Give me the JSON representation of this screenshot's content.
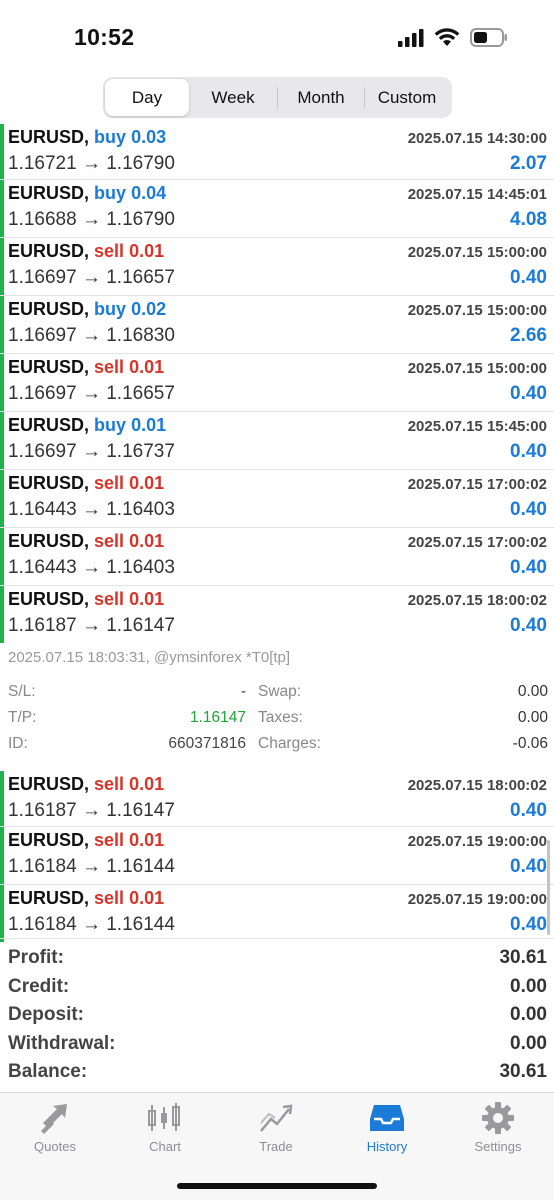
{
  "status": {
    "time": "10:52"
  },
  "tabs": [
    "Day",
    "Week",
    "Month",
    "Custom"
  ],
  "active_tab": "Day",
  "trades_top": [
    {
      "symbol": "EURUSD,",
      "dir": "buy",
      "vol": "0.03",
      "price": "1.16721 → 1.16790",
      "time": "2025.07.15 14:30:00",
      "pl": "2.07"
    },
    {
      "symbol": "EURUSD,",
      "dir": "buy",
      "vol": "0.04",
      "price": "1.16688 → 1.16790",
      "time": "2025.07.15 14:45:01",
      "pl": "4.08"
    },
    {
      "symbol": "EURUSD,",
      "dir": "sell",
      "vol": "0.01",
      "price": "1.16697 → 1.16657",
      "time": "2025.07.15 15:00:00",
      "pl": "0.40"
    },
    {
      "symbol": "EURUSD,",
      "dir": "buy",
      "vol": "0.02",
      "price": "1.16697 → 1.16830",
      "time": "2025.07.15 15:00:00",
      "pl": "2.66"
    },
    {
      "symbol": "EURUSD,",
      "dir": "sell",
      "vol": "0.01",
      "price": "1.16697 → 1.16657",
      "time": "2025.07.15 15:00:00",
      "pl": "0.40"
    },
    {
      "symbol": "EURUSD,",
      "dir": "buy",
      "vol": "0.01",
      "price": "1.16697 → 1.16737",
      "time": "2025.07.15 15:45:00",
      "pl": "0.40"
    },
    {
      "symbol": "EURUSD,",
      "dir": "sell",
      "vol": "0.01",
      "price": "1.16443 → 1.16403",
      "time": "2025.07.15 17:00:02",
      "pl": "0.40"
    },
    {
      "symbol": "EURUSD,",
      "dir": "sell",
      "vol": "0.01",
      "price": "1.16443 → 1.16403",
      "time": "2025.07.15 17:00:02",
      "pl": "0.40"
    },
    {
      "symbol": "EURUSD,",
      "dir": "sell",
      "vol": "0.01",
      "price": "1.16187 → 1.16147",
      "time": "2025.07.15 18:00:02",
      "pl": "0.40"
    }
  ],
  "detail": {
    "line": "2025.07.15 18:03:31, @ymsinforex *T0[tp]",
    "sl_label": "S/L:",
    "sl_value": "-",
    "tp_label": "T/P:",
    "tp_value": "1.16147",
    "id_label": "ID:",
    "id_value": "660371816",
    "swap_label": "Swap:",
    "swap_value": "0.00",
    "taxes_label": "Taxes:",
    "taxes_value": "0.00",
    "charges_label": "Charges:",
    "charges_value": "-0.06"
  },
  "trades_bottom": [
    {
      "symbol": "EURUSD,",
      "dir": "sell",
      "vol": "0.01",
      "price": "1.16187 → 1.16147",
      "time": "2025.07.15 18:00:02",
      "pl": "0.40"
    },
    {
      "symbol": "EURUSD,",
      "dir": "sell",
      "vol": "0.01",
      "price": "1.16184 → 1.16144",
      "time": "2025.07.15 19:00:00",
      "pl": "0.40"
    },
    {
      "symbol": "EURUSD,",
      "dir": "sell",
      "vol": "0.01",
      "price": "1.16184 → 1.16144",
      "time": "2025.07.15 19:00:00",
      "pl": "0.40"
    }
  ],
  "summary": [
    {
      "label": "Profit:",
      "value": "30.61"
    },
    {
      "label": "Credit:",
      "value": "0.00"
    },
    {
      "label": "Deposit:",
      "value": "0.00"
    },
    {
      "label": "Withdrawal:",
      "value": "0.00"
    },
    {
      "label": "Balance:",
      "value": "30.61"
    }
  ],
  "tabbar": [
    {
      "label": "Quotes",
      "icon": "quotes-icon"
    },
    {
      "label": "Chart",
      "icon": "chart-icon"
    },
    {
      "label": "Trade",
      "icon": "trade-icon"
    },
    {
      "label": "History",
      "icon": "history-icon"
    },
    {
      "label": "Settings",
      "icon": "settings-icon"
    }
  ],
  "active_tabbar": "History",
  "colors": {
    "buy": "#1a7bd8",
    "sell": "#d7352a",
    "accent": "#1a7bd8",
    "bar": "#21b04b",
    "tp": "#20a33a"
  }
}
